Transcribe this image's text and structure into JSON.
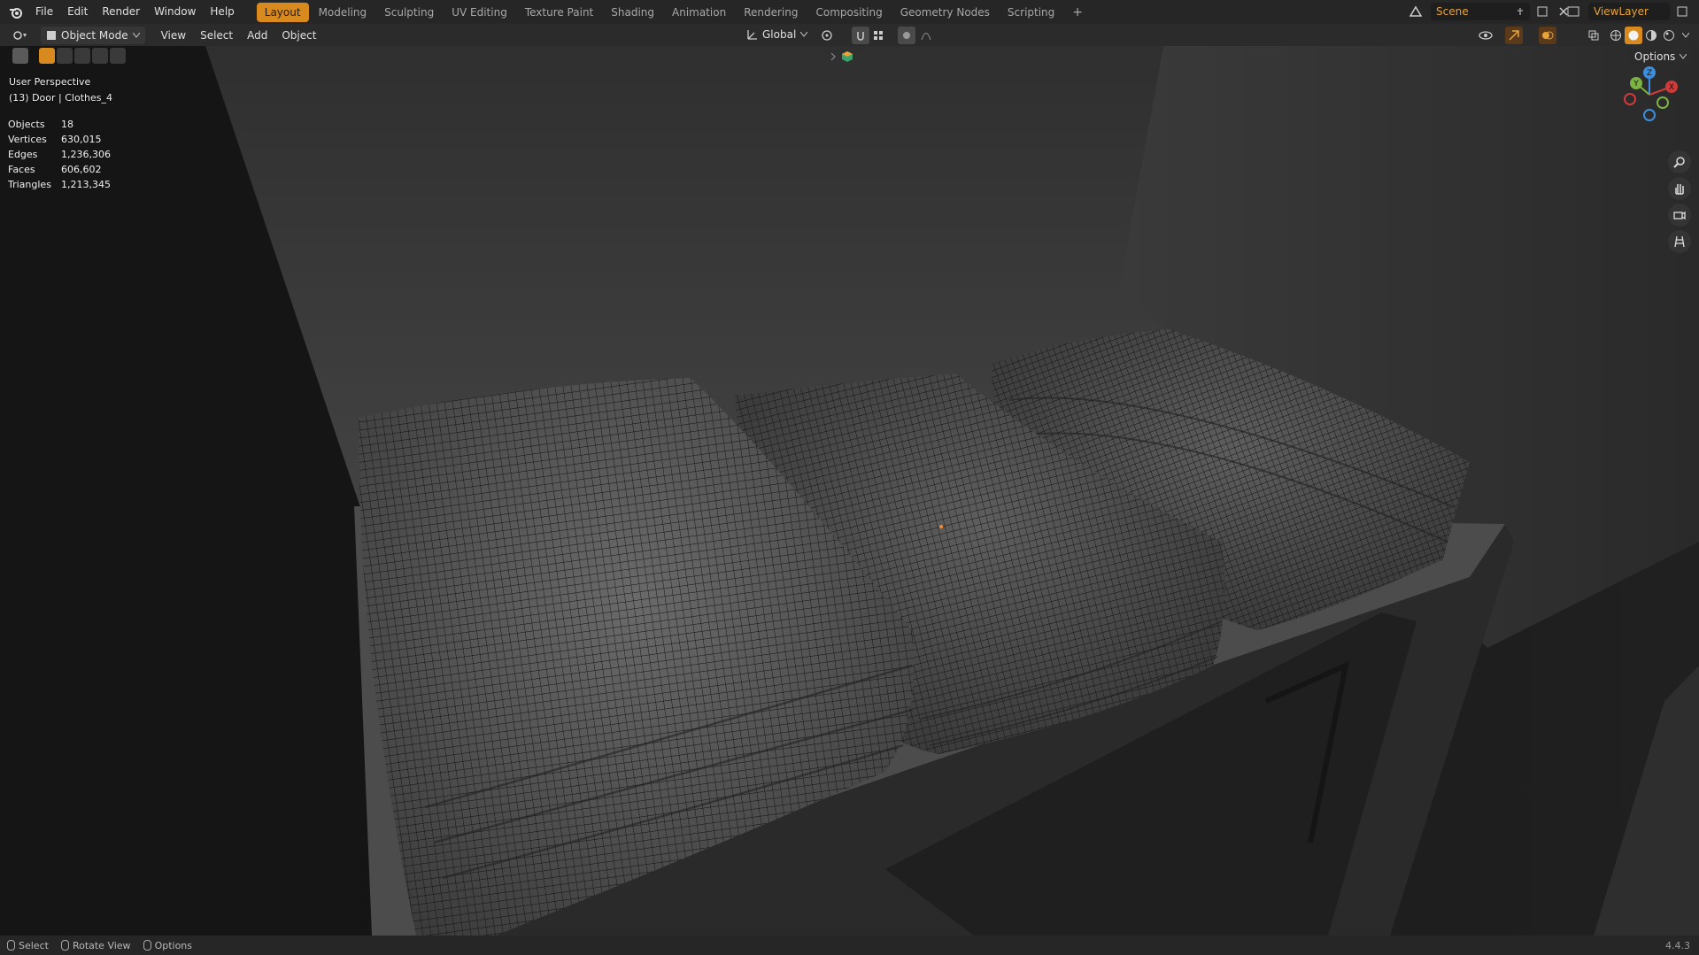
{
  "menu": {
    "items": [
      "File",
      "Edit",
      "Render",
      "Window",
      "Help"
    ]
  },
  "workspaces": {
    "tabs": [
      "Layout",
      "Modeling",
      "Sculpting",
      "UV Editing",
      "Texture Paint",
      "Shading",
      "Animation",
      "Rendering",
      "Compositing",
      "Geometry Nodes",
      "Scripting"
    ],
    "active": "Layout",
    "add_label": "+"
  },
  "scene": {
    "name": "Scene",
    "view_layer": "ViewLayer"
  },
  "header": {
    "mode": "Object Mode",
    "menus": [
      "View",
      "Select",
      "Add",
      "Object"
    ],
    "transform_orientation": "Global",
    "options_label": "Options"
  },
  "viewport": {
    "view_name": "User Perspective",
    "active_object": "(13) Door | Clothes_4",
    "stats": [
      {
        "label": "Objects",
        "value": "18"
      },
      {
        "label": "Vertices",
        "value": "630,015"
      },
      {
        "label": "Edges",
        "value": "1,236,306"
      },
      {
        "label": "Faces",
        "value": "606,602"
      },
      {
        "label": "Triangles",
        "value": "1,213,345"
      }
    ],
    "gizmo": {
      "x": "X",
      "y": "Y",
      "z": "Z"
    }
  },
  "statusbar": {
    "select": "Select",
    "rotate": "Rotate View",
    "options": "Options",
    "version": "4.4.3"
  },
  "colors": {
    "accent": "#d98a1f",
    "axis_x": "#d23a3a",
    "axis_y": "#7cb342",
    "axis_z": "#3c8fe0"
  }
}
